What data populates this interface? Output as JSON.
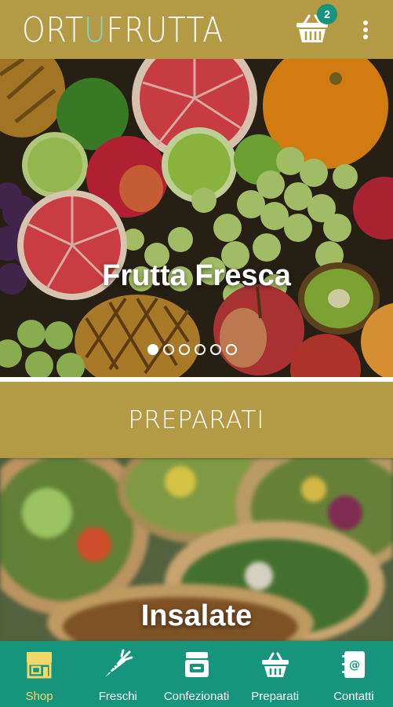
{
  "header": {
    "logo_part1": "ORT",
    "logo_accent": "U",
    "logo_part2": "FRUTTA",
    "cart_count": "2"
  },
  "hero": {
    "title": "Frutta Fresca",
    "slide_count": 6,
    "active_slide": 1
  },
  "section_band": {
    "label": "PREPARATI"
  },
  "salad": {
    "title": "Insalate"
  },
  "nav": {
    "items": [
      {
        "label": "Shop",
        "icon": "shop-icon",
        "active": true
      },
      {
        "label": "Freschi",
        "icon": "carrot-icon",
        "active": false
      },
      {
        "label": "Confezionati",
        "icon": "jar-icon",
        "active": false
      },
      {
        "label": "Preparati",
        "icon": "basket-icon",
        "active": false
      },
      {
        "label": "Contatti",
        "icon": "contacts-icon",
        "active": false
      }
    ]
  },
  "colors": {
    "brand_gold": "#b59a45",
    "nav_green": "#17957c",
    "active_yellow": "#f2d86a"
  }
}
